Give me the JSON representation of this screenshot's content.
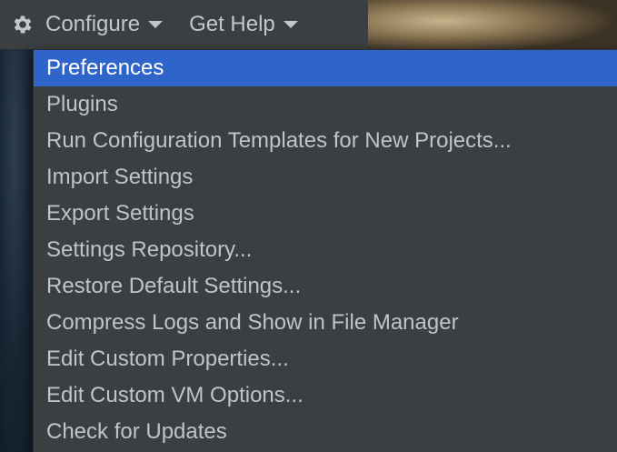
{
  "toolbar": {
    "configure_label": "Configure",
    "get_help_label": "Get Help",
    "icons": {
      "configure": "gear-icon",
      "dropdown": "chevron-down-icon"
    }
  },
  "menu": {
    "selected_index": 0,
    "items": [
      {
        "label": "Preferences"
      },
      {
        "label": "Plugins"
      },
      {
        "label": "Run Configuration Templates for New Projects..."
      },
      {
        "label": "Import Settings"
      },
      {
        "label": "Export Settings"
      },
      {
        "label": "Settings Repository..."
      },
      {
        "label": "Restore Default Settings..."
      },
      {
        "label": "Compress Logs and Show in File Manager"
      },
      {
        "label": "Edit Custom Properties..."
      },
      {
        "label": "Edit Custom VM Options..."
      },
      {
        "label": "Check for Updates"
      }
    ]
  },
  "colors": {
    "toolbar_bg": "#3b3f41",
    "menu_bg": "#3c3f41",
    "selection": "#2f65ca",
    "text": "#c1c3c5",
    "selected_text": "#ffffff"
  }
}
